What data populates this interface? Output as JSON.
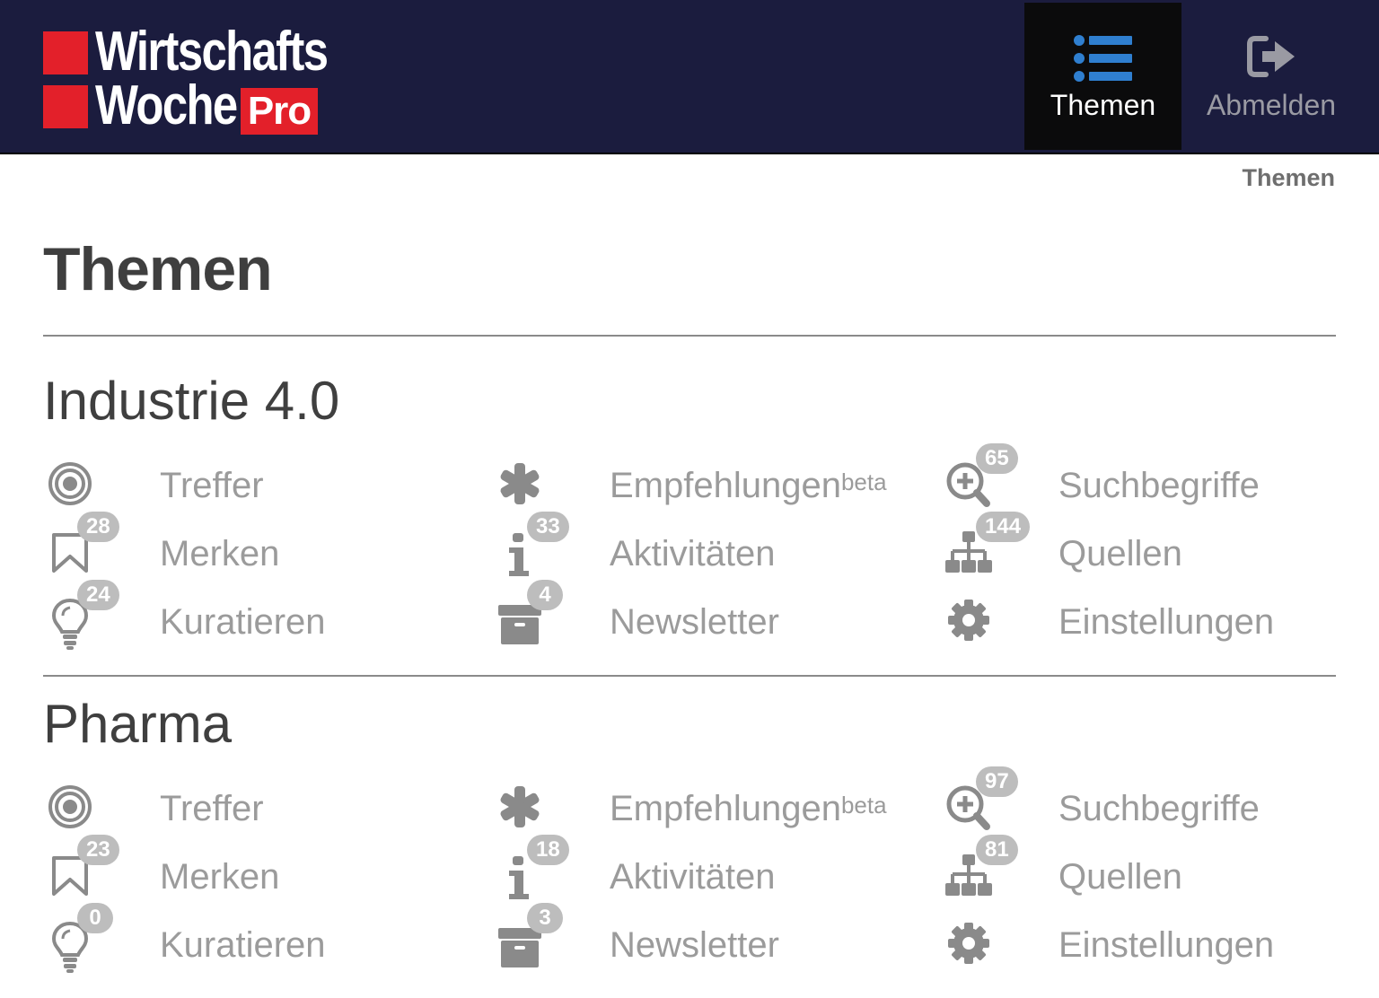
{
  "logo": {
    "line1": "Wirtschafts",
    "line2": "Woche",
    "pro": "Pro"
  },
  "nav": {
    "themen": "Themen",
    "abmelden": "Abmelden"
  },
  "breadcrumb": "Themen",
  "page_title": "Themen",
  "colors": {
    "header_bg": "#1b1c3e",
    "brand_red": "#e3202a",
    "accent_blue": "#2f7fd0",
    "icon_grey": "#8a8a8a",
    "badge_grey": "#bdbdbd"
  },
  "sections": [
    {
      "title": "Industrie 4.0",
      "items": {
        "treffer": {
          "label": "Treffer",
          "icon": "target-icon"
        },
        "merken": {
          "label": "Merken",
          "badge": "28",
          "icon": "bookmark-icon"
        },
        "kuratieren": {
          "label": "Kuratieren",
          "badge": "24",
          "icon": "lightbulb-icon"
        },
        "empfehlungen": {
          "label": "Empfehlungen",
          "sup": "beta",
          "icon": "asterisk-icon"
        },
        "aktivitaeten": {
          "label": "Aktivitäten",
          "badge": "33",
          "icon": "info-icon"
        },
        "newsletter": {
          "label": "Newsletter",
          "badge": "4",
          "icon": "archive-icon"
        },
        "suchbegriffe": {
          "label": "Suchbegriffe",
          "badge": "65",
          "icon": "zoom-in-icon"
        },
        "quellen": {
          "label": "Quellen",
          "badge": "144",
          "icon": "sitemap-icon"
        },
        "einstellungen": {
          "label": "Einstellungen",
          "icon": "gear-icon"
        }
      }
    },
    {
      "title": "Pharma",
      "items": {
        "treffer": {
          "label": "Treffer",
          "icon": "target-icon"
        },
        "merken": {
          "label": "Merken",
          "badge": "23",
          "icon": "bookmark-icon"
        },
        "kuratieren": {
          "label": "Kuratieren",
          "badge": "0",
          "icon": "lightbulb-icon"
        },
        "empfehlungen": {
          "label": "Empfehlungen",
          "sup": "beta",
          "icon": "asterisk-icon"
        },
        "aktivitaeten": {
          "label": "Aktivitäten",
          "badge": "18",
          "icon": "info-icon"
        },
        "newsletter": {
          "label": "Newsletter",
          "badge": "3",
          "icon": "archive-icon"
        },
        "suchbegriffe": {
          "label": "Suchbegriffe",
          "badge": "97",
          "icon": "zoom-in-icon"
        },
        "quellen": {
          "label": "Quellen",
          "badge": "81",
          "icon": "sitemap-icon"
        },
        "einstellungen": {
          "label": "Einstellungen",
          "icon": "gear-icon"
        }
      }
    }
  ]
}
